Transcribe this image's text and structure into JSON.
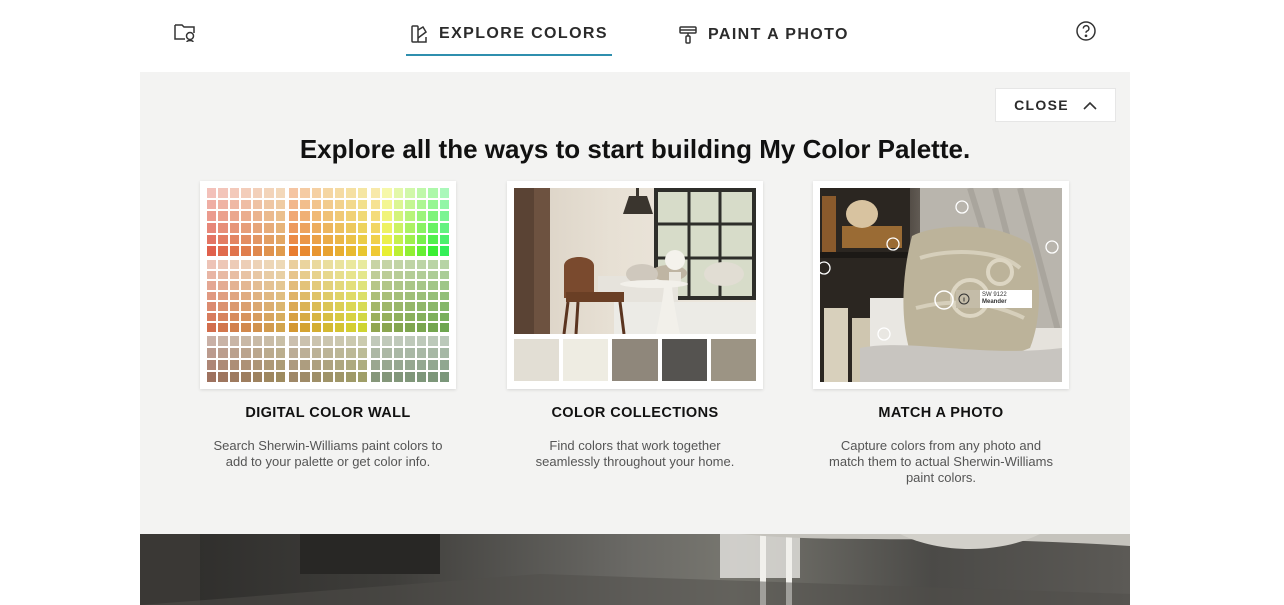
{
  "nav": {
    "tabs": [
      {
        "label": "EXPLORE COLORS",
        "icon": "palette-swatch-icon",
        "active": true
      },
      {
        "label": "PAINT A PHOTO",
        "icon": "paint-roller-icon",
        "active": false
      }
    ],
    "left_icon": "folder-search-icon",
    "right_icon": "help-icon"
  },
  "panel": {
    "close_label": "CLOSE",
    "headline": "Explore all the ways to start building My Color Palette.",
    "cards": [
      {
        "title": "DIGITAL COLOR WALL",
        "desc": "Search Sherwin-Williams paint colors to add to your palette or get color info."
      },
      {
        "title": "COLOR COLLECTIONS",
        "desc": "Find colors that work together seamlessly throughout your home."
      },
      {
        "title": "MATCH A PHOTO",
        "desc": "Capture colors from any photo and match them to actual Sherwin-Williams paint colors."
      }
    ],
    "collection_swatches": [
      "#e2ded4",
      "#eeece2",
      "#8f877b",
      "#555350",
      "#9c9484"
    ],
    "photo_tag": {
      "code": "SW 9122",
      "name": "Meander"
    }
  },
  "colors": {
    "accent": "#2f8fae",
    "panel_bg": "#f3f3f2"
  }
}
